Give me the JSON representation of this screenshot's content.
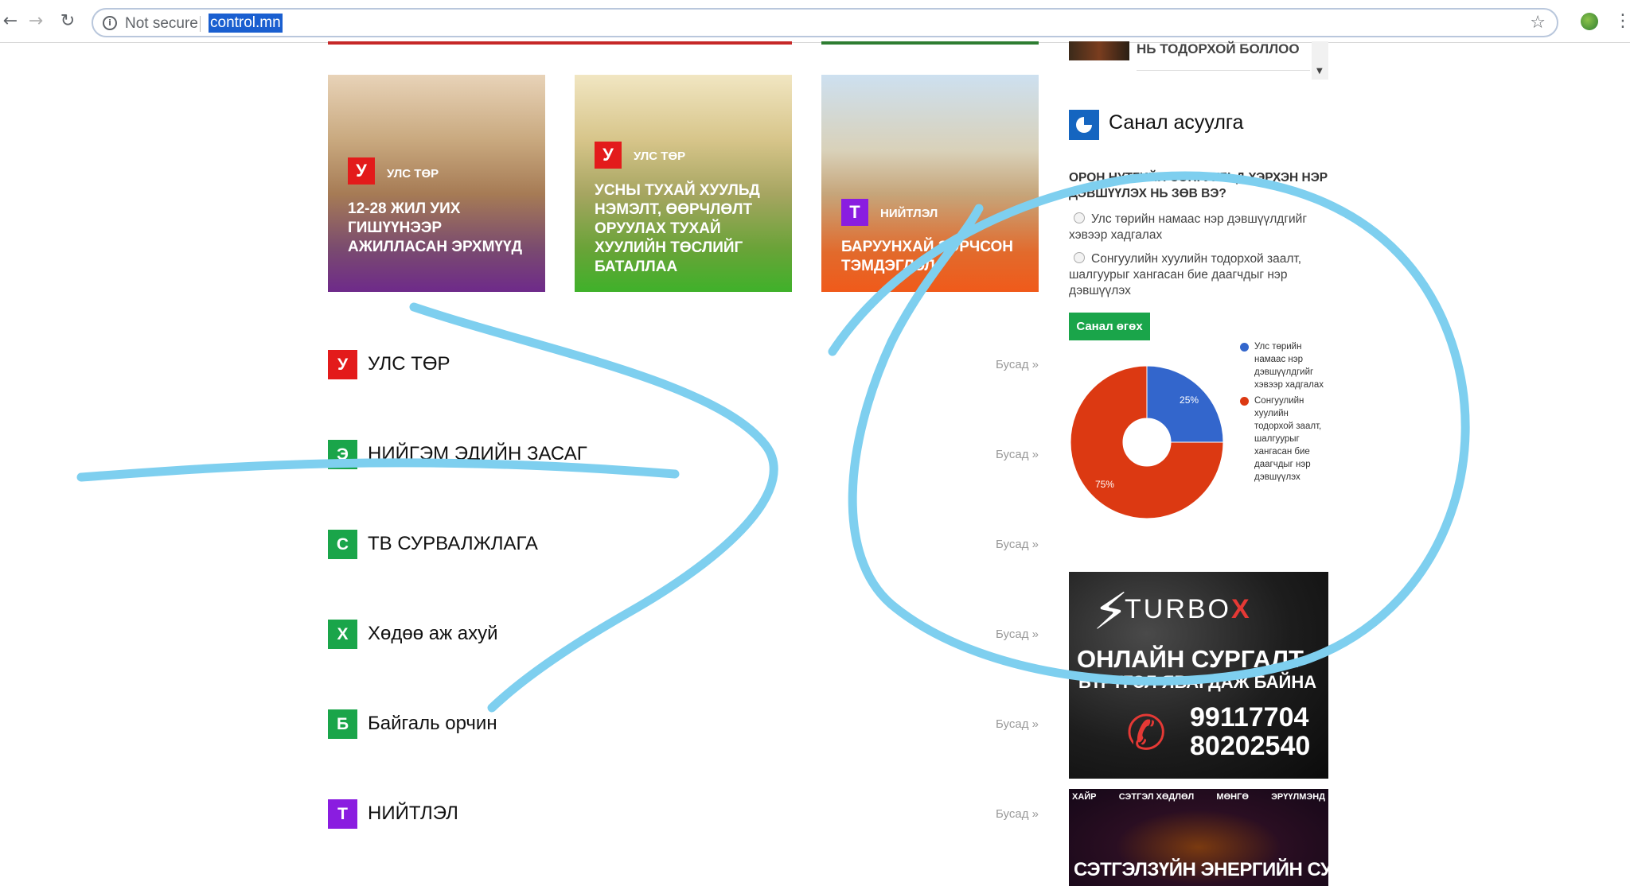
{
  "browser": {
    "security_label": "Not secure",
    "url": "control.mn"
  },
  "sidebar_news": {
    "headline": "НЬ ТОДОРХОЙ БОЛЛОО"
  },
  "featured": [
    {
      "badge": "У",
      "category": "УЛС ТӨР",
      "title": "12-28 ЖИЛ УИХ ГИШҮҮНЭЭР АЖИЛЛАСАН ЭРХМҮҮД",
      "badge_color": "#e31b1b"
    },
    {
      "badge": "У",
      "category": "УЛС ТӨР",
      "title": "УСНЫ ТУХАЙ ХУУЛЬД НЭМЭЛТ, ӨӨРЧЛӨЛТ ОРУУЛАХ ТУХАЙ ХУУЛИЙН ТӨСЛИЙГ БАТАЛЛАА",
      "badge_color": "#e31b1b"
    },
    {
      "badge": "Т",
      "category": "НИЙТЛЭЛ",
      "title": "БАРУУНХАЙ ЗОРЧСОН ТЭМДЭГЛЭЛ",
      "badge_color": "#8a1de0"
    }
  ],
  "sections": [
    {
      "badge": "У",
      "title": "УЛС ТӨР",
      "more": "Бусад »",
      "color": "#e31b1b"
    },
    {
      "badge": "Э",
      "title": "НИЙГЭМ ЭДИЙН ЗАСАГ",
      "more": "Бусад »",
      "color": "#1aa54a"
    },
    {
      "badge": "С",
      "title": "ТВ СУРВАЛЖЛАГА",
      "more": "Бусад »",
      "color": "#1aa54a"
    },
    {
      "badge": "Х",
      "title": "Хөдөө аж ахуй",
      "more": "Бусад »",
      "color": "#1aa54a"
    },
    {
      "badge": "Б",
      "title": "Байгаль орчин",
      "more": "Бусад »",
      "color": "#1aa54a"
    },
    {
      "badge": "Т",
      "title": "НИЙТЛЭЛ",
      "more": "Бусад »",
      "color": "#8a1de0"
    }
  ],
  "poll": {
    "heading": "Санал асуулга",
    "question": "ОРОН НУТГИЙН СОНГУУЛЬД ХЭРХЭН НЭР ДЭВШҮҮЛЭХ НЬ ЗӨВ ВЭ?",
    "options": [
      "Улс төрийн намаас нэр дэвшүүлдгийг хэвээр хадгалах",
      "Сонгуулийн хуулийн тодорхой заалт, шалгуурыг хангасан бие даагчдыг нэр дэвшүүлэх"
    ],
    "vote_label": "Санал өгөх"
  },
  "chart_data": {
    "type": "pie",
    "categories": [
      "Улс төрийн намаас нэр дэвшүүлдгийг хэвээр хадгалах",
      "Сонгуулийн хуулийн тодорхой заалт, шалгуурыг хангасан бие даагчдыг нэр дэвшүүлэх"
    ],
    "values": [
      25,
      75
    ],
    "labels": [
      "25%",
      "75%"
    ],
    "colors": [
      "#3366cc",
      "#dc3912"
    ],
    "donut": true,
    "legend_position": "right"
  },
  "ads": {
    "turbo_brand": "TURBO",
    "turbo_brand_x": "X",
    "turbo_line1": "ОНЛАЙН СУРГАЛТ",
    "turbo_line2": "БҮРТГЭЛ ЯВАГДАЖ БАЙНА",
    "turbo_phone1": "99117704",
    "turbo_phone2": "80202540",
    "energy_tabs": [
      "ХАЙР",
      "СЭТГЭЛ ХӨДЛӨЛ",
      "МӨНГӨ",
      "ЭРҮҮЛМЭНД"
    ],
    "energy_title": "СЭТГЭЛЗҮЙН ЭНЕРГИЙН СУРГАЛТ"
  }
}
